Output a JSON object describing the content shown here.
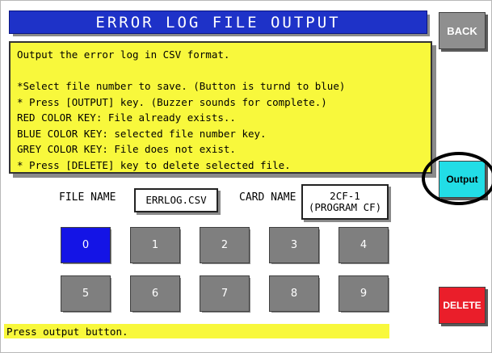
{
  "screen": {
    "title": "ERROR LOG FILE OUTPUT"
  },
  "info": {
    "lines": [
      "Output the error log in CSV format.",
      "",
      "*Select file number to save. (Button is turnd to blue)",
      "* Press [OUTPUT] key. (Buzzer sounds for complete.)",
      "RED COLOR KEY: File already exists..",
      "BLUE COLOR KEY: selected file number key.",
      "GREY COLOR KEY: File does not exist.",
      "* Press [DELETE] key to delete selected file."
    ]
  },
  "buttons": {
    "back": "BACK",
    "output": "Output",
    "delete": "DELETE"
  },
  "file": {
    "name_label": "FILE NAME",
    "name_value": "ERRLOG.CSV",
    "card_label": "CARD NAME",
    "card_value_line1": "2CF-1",
    "card_value_line2": "(PROGRAM CF)"
  },
  "keys": [
    {
      "label": "0",
      "selected": true
    },
    {
      "label": "1",
      "selected": false
    },
    {
      "label": "2",
      "selected": false
    },
    {
      "label": "3",
      "selected": false
    },
    {
      "label": "4",
      "selected": false
    },
    {
      "label": "5",
      "selected": false
    },
    {
      "label": "6",
      "selected": false
    },
    {
      "label": "7",
      "selected": false
    },
    {
      "label": "8",
      "selected": false
    },
    {
      "label": "9",
      "selected": false
    }
  ],
  "status": "Press output button.",
  "colors": {
    "title_bg": "#1e32c8",
    "info_bg": "#f8f83c",
    "selected_key": "#1414e6",
    "gray_key": "#7f7f7f",
    "output_btn": "#22dde6",
    "delete_btn": "#ea1e2a"
  }
}
